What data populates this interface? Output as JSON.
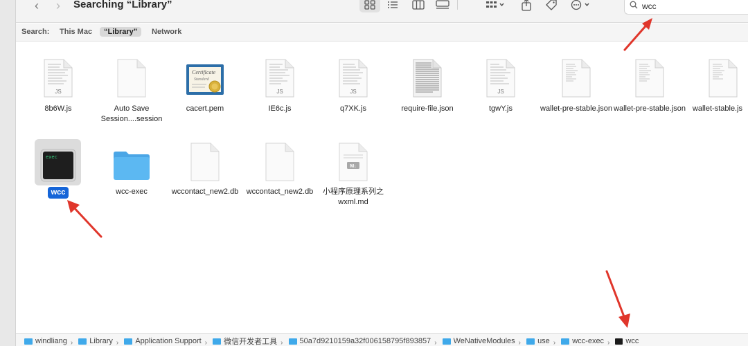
{
  "window": {
    "title": "Searching “Library”"
  },
  "toolbar": {
    "back_glyph": "‹",
    "forward_glyph": "›",
    "icons": [
      "icon-view-grid-icon",
      "list-view-icon",
      "column-view-icon",
      "gallery-view-icon",
      "group-icon",
      "share-icon",
      "tag-icon",
      "more-actions-icon"
    ]
  },
  "search": {
    "value": "wcc"
  },
  "scope": {
    "label": "Search:",
    "items": [
      "This Mac",
      "“Library”",
      "Network"
    ],
    "active_index": 1
  },
  "files": [
    {
      "name": "8b6W.js",
      "kind": "js"
    },
    {
      "name": "Auto Save Session....session",
      "kind": "blank"
    },
    {
      "name": "cacert.pem",
      "kind": "certificate"
    },
    {
      "name": "IE6c.js",
      "kind": "js"
    },
    {
      "name": "q7XK.js",
      "kind": "js"
    },
    {
      "name": "require-file.json",
      "kind": "dense-text"
    },
    {
      "name": "tgwY.js",
      "kind": "js"
    },
    {
      "name": "wallet-pre-stable.json",
      "kind": "text"
    },
    {
      "name": "wallet-pre-stable.json",
      "kind": "text"
    },
    {
      "name": "wallet-stable.js",
      "kind": "text"
    },
    {
      "name": "wcc",
      "kind": "exec",
      "selected": true
    },
    {
      "name": "wcc-exec",
      "kind": "folder"
    },
    {
      "name": "wccontact_new2.db",
      "kind": "blank"
    },
    {
      "name": "wccontact_new2.db",
      "kind": "blank"
    },
    {
      "name": "小程序原理系列之wxml.md",
      "kind": "markdown"
    }
  ],
  "icon_labels": {
    "js": "JS",
    "exec": "exec",
    "markdown": "M↓",
    "cert_line1": "Certificate",
    "cert_line2": "Standard"
  },
  "path": [
    {
      "name": "windliang",
      "kind": "folder"
    },
    {
      "name": "Library",
      "kind": "folder"
    },
    {
      "name": "Application Support",
      "kind": "folder"
    },
    {
      "name": "微信开发者工具",
      "kind": "folder"
    },
    {
      "name": "50a7d9210159a32f006158795f893857",
      "kind": "folder"
    },
    {
      "name": "WeNativeModules",
      "kind": "folder"
    },
    {
      "name": "use",
      "kind": "folder"
    },
    {
      "name": "wcc-exec",
      "kind": "folder"
    },
    {
      "name": "wcc",
      "kind": "exec"
    }
  ],
  "path_separator": "›",
  "colors": {
    "selection": "#1565d8",
    "folder": "#3fa9ea",
    "annotation_arrow": "#e0362b"
  }
}
